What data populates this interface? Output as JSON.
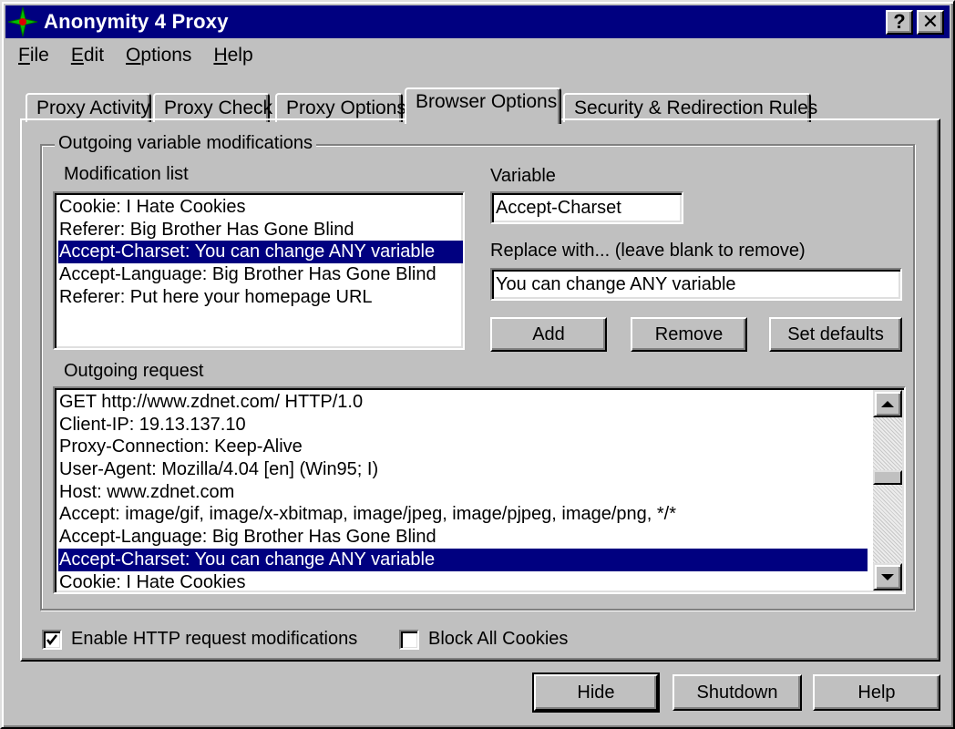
{
  "window": {
    "title": "Anonymity 4 Proxy",
    "app_icon": "compass-star-icon",
    "help_button_glyph": "?",
    "close_button_glyph": "✕"
  },
  "menu": [
    {
      "accel": "F",
      "rest": "ile"
    },
    {
      "accel": "E",
      "rest": "dit"
    },
    {
      "accel": "O",
      "rest": "ptions"
    },
    {
      "accel": "H",
      "rest": "elp"
    }
  ],
  "tabs": [
    {
      "label": "Proxy Activity",
      "active": false
    },
    {
      "label": "Proxy Check",
      "active": false
    },
    {
      "label": "Proxy Options",
      "active": false
    },
    {
      "label": "Browser Options",
      "active": true
    },
    {
      "label": "Security & Redirection Rules",
      "active": false
    }
  ],
  "group": {
    "title": "Outgoing variable modifications",
    "modification_list_label": "Modification list",
    "modification_list": [
      {
        "text": "Cookie: I Hate Cookies",
        "selected": false
      },
      {
        "text": "Referer: Big Brother Has Gone Blind",
        "selected": false
      },
      {
        "text": "Accept-Charset: You can change ANY variable",
        "selected": true
      },
      {
        "text": "Accept-Language: Big Brother Has Gone Blind",
        "selected": false
      },
      {
        "text": "Referer: Put here your homepage URL",
        "selected": false
      }
    ],
    "variable_label": "Variable",
    "variable_value": "Accept-Charset",
    "replace_label": "Replace with... (leave blank to remove)",
    "replace_value": "You can change ANY variable",
    "buttons": {
      "add": "Add",
      "remove": "Remove",
      "set_defaults": "Set defaults"
    },
    "outgoing_request_label": "Outgoing request",
    "outgoing_request": [
      {
        "text": "GET http://www.zdnet.com/ HTTP/1.0",
        "selected": false
      },
      {
        "text": "Client-IP: 19.13.137.10",
        "selected": false
      },
      {
        "text": "Proxy-Connection: Keep-Alive",
        "selected": false
      },
      {
        "text": "User-Agent: Mozilla/4.04 [en] (Win95; I)",
        "selected": false
      },
      {
        "text": "Host: www.zdnet.com",
        "selected": false
      },
      {
        "text": "Accept: image/gif, image/x-xbitmap, image/jpeg, image/pjpeg, image/png, */*",
        "selected": false
      },
      {
        "text": "Accept-Language: Big Brother Has Gone Blind",
        "selected": false
      },
      {
        "text": "Accept-Charset: You can change ANY variable",
        "selected": true
      },
      {
        "text": "Cookie: I Hate Cookies",
        "selected": false
      }
    ]
  },
  "checkboxes": {
    "enable_modifications": {
      "label": "Enable HTTP request modifications",
      "checked": true
    },
    "block_cookies": {
      "label": "Block All Cookies",
      "checked": false
    }
  },
  "footer_buttons": {
    "hide": "Hide",
    "shutdown": "Shutdown",
    "help": "Help"
  },
  "colors": {
    "selection": "#000080",
    "titlebar": "#000080",
    "face": "#c0c0c0"
  }
}
